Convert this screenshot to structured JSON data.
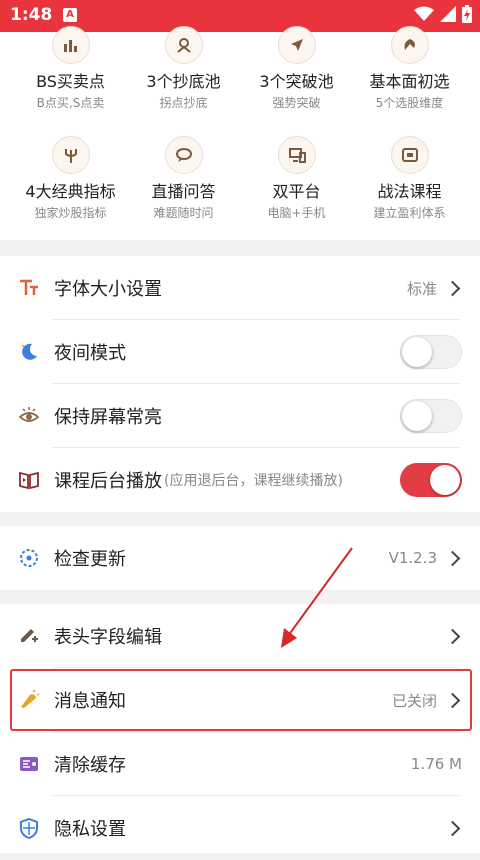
{
  "status_bar": {
    "time": "1:48",
    "app_icon": "A"
  },
  "features": [
    {
      "title": "BS买卖点",
      "subtitle": "B点买,S点卖",
      "icon": "bs-chart-icon"
    },
    {
      "title": "3个抄底池",
      "subtitle": "拐点抄底",
      "icon": "bottom-fishing-icon"
    },
    {
      "title": "3个突破池",
      "subtitle": "强势突破",
      "icon": "breakout-arrow-icon"
    },
    {
      "title": "基本面初选",
      "subtitle": "5个选股维度",
      "icon": "fundamentals-icon"
    },
    {
      "title": "4大经典指标",
      "subtitle": "独家炒股指标",
      "icon": "trident-icon"
    },
    {
      "title": "直播问答",
      "subtitle": "难题随时问",
      "icon": "chat-bubble-icon"
    },
    {
      "title": "双平台",
      "subtitle": "电脑+手机",
      "icon": "devices-icon"
    },
    {
      "title": "战法课程",
      "subtitle": "建立盈利体系",
      "icon": "course-video-icon"
    }
  ],
  "settings": {
    "font_size": {
      "label": "字体大小设置",
      "value": "标准"
    },
    "night_mode": {
      "label": "夜间模式",
      "on": false
    },
    "keep_screen_on": {
      "label": "保持屏幕常亮",
      "on": false
    },
    "background_play": {
      "label": "课程后台播放",
      "hint": "(应用退后台，课程继续播放)",
      "on": true
    },
    "check_update": {
      "label": "检查更新",
      "value": "V1.2.3"
    },
    "header_edit": {
      "label": "表头字段编辑"
    },
    "notifications": {
      "label": "消息通知",
      "value": "已关闭"
    },
    "clear_cache": {
      "label": "清除缓存",
      "value": "1.76 M"
    },
    "privacy": {
      "label": "隐私设置"
    }
  },
  "colors": {
    "accent": "#e9343e",
    "toggle_on": "#e33c43",
    "highlight": "#e43a3a"
  }
}
